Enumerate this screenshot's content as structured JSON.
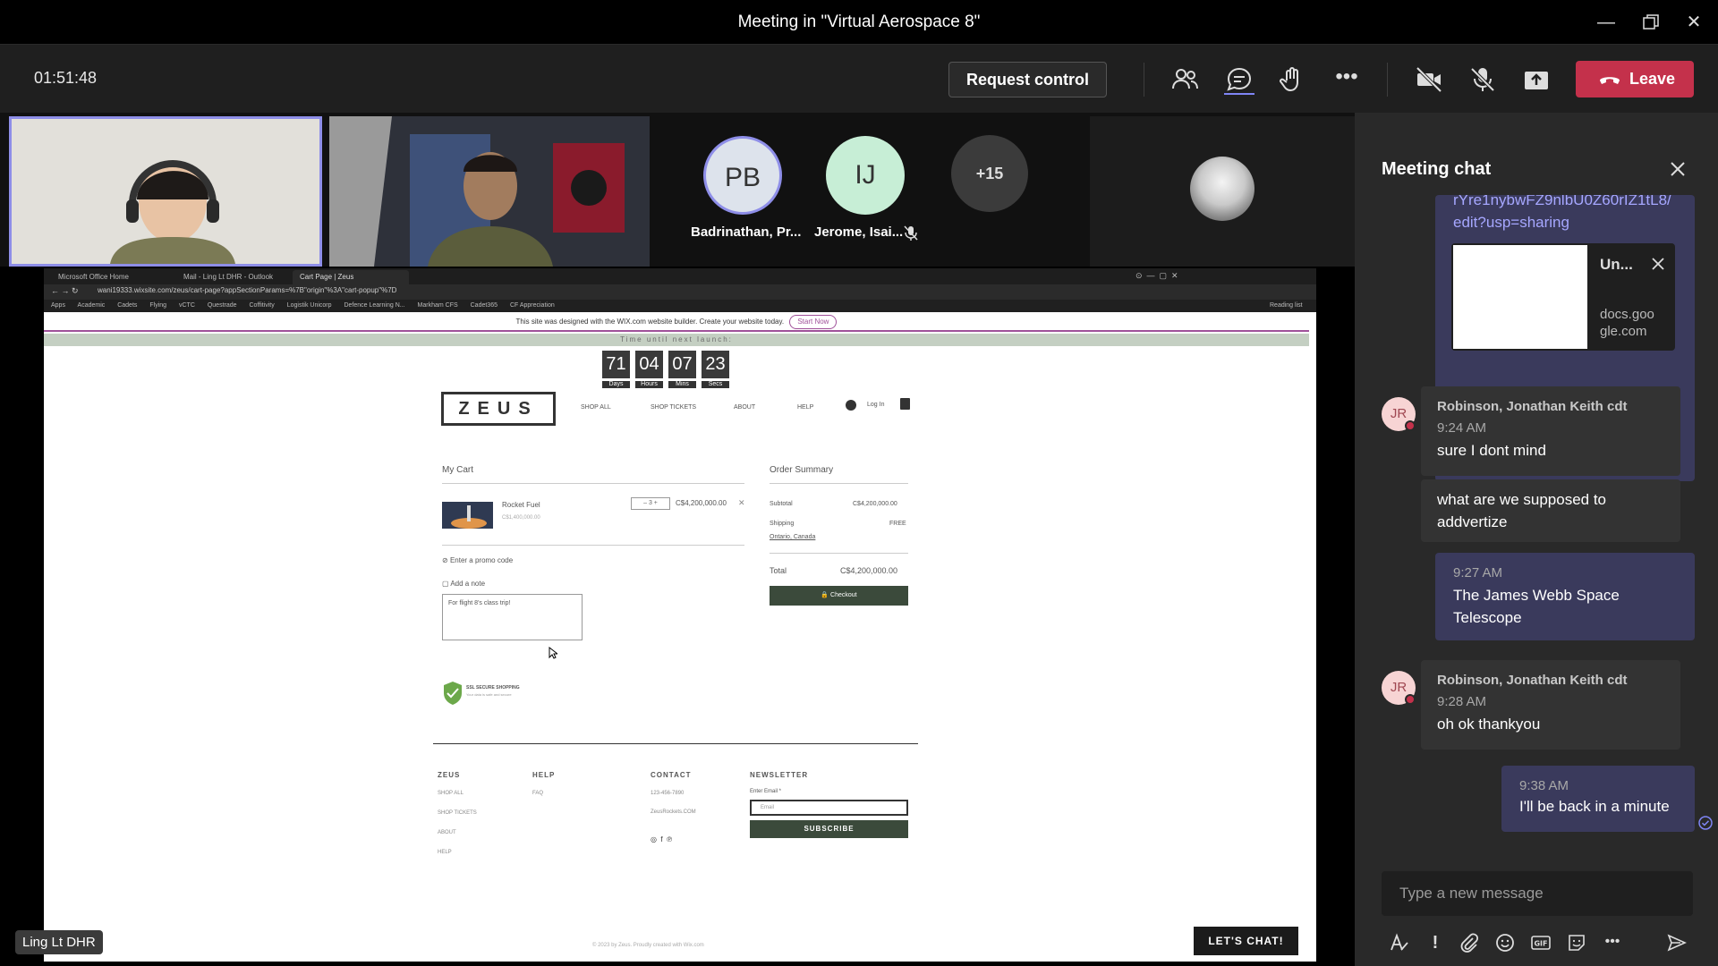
{
  "window": {
    "title": "Meeting in \"Virtual Aerospace 8\""
  },
  "toolbar": {
    "timer": "01:51:48",
    "request_control": "Request control",
    "leave": "Leave",
    "leave_color": "#c4314b"
  },
  "participants": [
    {
      "initials": "PB",
      "name": "Badrinathan, Pr..."
    },
    {
      "initials": "IJ",
      "name": "Jerome, Isai..."
    }
  ],
  "overflow_count": "+15",
  "presenter_badge": "Ling Lt DHR",
  "browser": {
    "tabs": [
      "Microsoft Office Home",
      "Mail - Ling Lt DHR - Outlook",
      "Cart Page | Zeus"
    ],
    "url": "wani19333.wixsite.com/zeus/cart-page?appSectionParams=%7B\"origin\"%3A\"cart-popup\"%7D",
    "bookmarks": [
      "Apps",
      "Academic",
      "Cadets",
      "Flying",
      "vCTC",
      "Questrade",
      "Coffitivity",
      "Logistik Unicorp",
      "Defence Learning N...",
      "Markham CFS",
      "Cadet365",
      "CF Appreciation"
    ],
    "reading_list": "Reading list"
  },
  "site": {
    "wix_banner": "This site was designed with the WIX.com website builder. Create your website today.",
    "wix_start": "Start Now",
    "launch_label": "Time until next launch:",
    "countdown": [
      {
        "value": "71",
        "label": "Days"
      },
      {
        "value": "04",
        "label": "Hours"
      },
      {
        "value": "07",
        "label": "Mins"
      },
      {
        "value": "23",
        "label": "Secs"
      }
    ],
    "logo": "ZEUS",
    "nav": [
      "SHOP ALL",
      "SHOP TICKETS",
      "ABOUT",
      "HELP"
    ],
    "login": "Log In",
    "cart": {
      "title": "My Cart",
      "item_name": "Rocket Fuel",
      "item_unit_price": "C$1,400,000.00",
      "quantity": "3",
      "item_total": "C$4,200,000.00",
      "promo": "Enter a promo code",
      "add_note": "Add a note",
      "note_text": "For flight 8's class trip!"
    },
    "summary": {
      "title": "Order Summary",
      "subtotal_label": "Subtotal",
      "subtotal": "C$4,200,000.00",
      "shipping_label": "Shipping",
      "shipping": "FREE",
      "location": "Ontario, Canada",
      "total_label": "Total",
      "total": "C$4,200,000.00",
      "checkout": "Checkout"
    },
    "secure": "SSL SECURE SHOPPING",
    "secure_sub": "Your data is safe and secure",
    "footer": {
      "col1_title": "ZEUS",
      "col1": [
        "SHOP ALL",
        "SHOP TICKETS",
        "ABOUT",
        "HELP"
      ],
      "col2_title": "HELP",
      "col2": [
        "FAQ"
      ],
      "col3_title": "CONTACT",
      "col3": [
        "123-456-7890",
        "ZeusRockets.COM"
      ],
      "newsletter_title": "NEWSLETTER",
      "email_label": "Enter Email *",
      "email_placeholder": "Email",
      "subscribe": "SUBSCRIBE",
      "copyright": "© 2023 by Zeus. Proudly created with Wix.com"
    },
    "lets_chat": "LET'S CHAT!"
  },
  "chat": {
    "title": "Meeting chat",
    "link_fragment": "rYre1nybwFZ9nlbU0Z60rIZ1tL8/",
    "link_tail": "edit?usp=sharing",
    "preview_title": "Un...",
    "preview_domain": "docs.goo gle.com",
    "messages": [
      {
        "sender": "Robinson, Jonathan Keith cdt",
        "initials": "JR",
        "time": "9:24 AM",
        "lines": [
          "sure I dont mind",
          "what are we supposed to addvertize"
        ]
      },
      {
        "mine": true,
        "time": "9:27 AM",
        "text": "The James Webb Space Telescope"
      },
      {
        "sender": "Robinson, Jonathan Keith cdt",
        "initials": "JR",
        "time": "9:28 AM",
        "text": "oh ok thankyou"
      },
      {
        "mine": true,
        "time": "9:38 AM",
        "text": "I'll be back in a minute"
      }
    ],
    "compose_placeholder": "Type a new message"
  }
}
